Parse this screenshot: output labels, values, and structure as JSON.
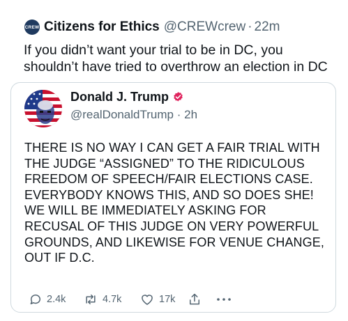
{
  "tweet": {
    "avatar_text": "CREW",
    "author_name": "Citizens for Ethics",
    "author_handle": "@CREWcrew",
    "separator": "·",
    "timestamp": "22m",
    "text_lines": [
      "If you didn’t want your trial to be in DC, you",
      "shouldn’t have tried to overthrow an election in DC"
    ]
  },
  "quote": {
    "author_name": "Donald J. Trump",
    "verified_badge_color": "#e0245e",
    "author_handle": "@realDonaldTrump",
    "separator": "·",
    "timestamp": "2h",
    "body_lines": [
      "THERE IS NO WAY I CAN GET A FAIR TRIAL WITH",
      "THE JUDGE “ASSIGNED” TO THE RIDICULOUS",
      "FREEDOM OF SPEECH/FAIR ELECTIONS CASE.",
      "EVERYBODY KNOWS THIS, AND SO DOES SHE!",
      "WE WILL BE IMMEDIATELY ASKING FOR",
      "RECUSAL OF THIS JUDGE ON VERY POWERFUL",
      "GROUNDS, AND LIKEWISE FOR VENUE CHANGE,",
      "OUT IF D.C."
    ],
    "actions": {
      "reply_icon": "speech-bubble-icon",
      "reply_count": "2.4k",
      "retweet_icon": "retweet-arrows-icon",
      "retweet_count": "4.7k",
      "like_icon": "heart-icon",
      "like_count": "17k",
      "share_icon": "share-upload-icon",
      "more_icon": "ellipsis-icon"
    }
  }
}
